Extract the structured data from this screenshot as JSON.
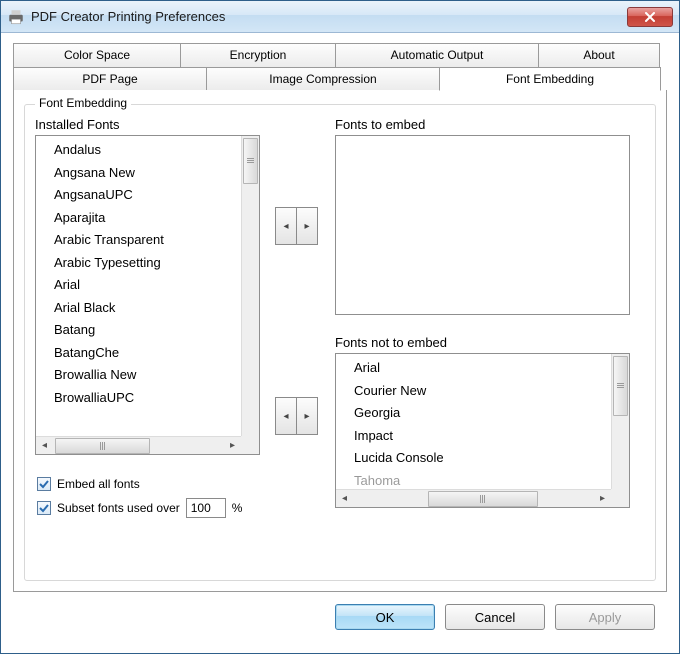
{
  "window": {
    "title": "PDF Creator Printing Preferences"
  },
  "tabs": {
    "row1": [
      "Color Space",
      "Encryption",
      "Automatic Output",
      "About"
    ],
    "row2": [
      "PDF Page",
      "Image Compression",
      "Font Embedding"
    ],
    "active": "Font Embedding"
  },
  "group": {
    "label": "Font Embedding"
  },
  "labels": {
    "installed": "Installed Fonts",
    "toEmbed": "Fonts to embed",
    "notEmbed": "Fonts not to embed",
    "embedAll": "Embed all fonts",
    "subsetOver": "Subset fonts used over",
    "percent": "%"
  },
  "installed_fonts": [
    "Andalus",
    "Angsana New",
    "AngsanaUPC",
    "Aparajita",
    "Arabic Transparent",
    "Arabic Typesetting",
    "Arial",
    "Arial Black",
    "Batang",
    "BatangChe",
    "Browallia New",
    "BrowalliaUPC"
  ],
  "fonts_to_embed": [],
  "fonts_not_to_embed": [
    "Arial",
    "Courier New",
    "Georgia",
    "Impact",
    "Lucida Console",
    "Tahoma"
  ],
  "check": {
    "embedAll": true,
    "subsetOver": true
  },
  "subset_value": "100",
  "buttons": {
    "ok": "OK",
    "cancel": "Cancel",
    "apply": "Apply"
  }
}
